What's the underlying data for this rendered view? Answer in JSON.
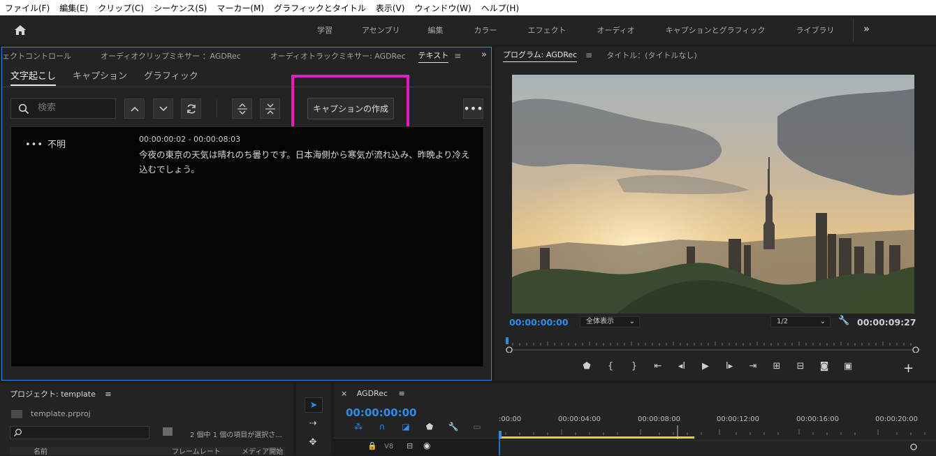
{
  "menu": [
    "ファイル(F)",
    "編集(E)",
    "クリップ(C)",
    "シーケンス(S)",
    "マーカー(M)",
    "グラフィックとタイトル",
    "表示(V)",
    "ウィンドウ(W)",
    "ヘルプ(H)"
  ],
  "workspaces": [
    "学習",
    "アセンブリ",
    "編集",
    "カラー",
    "エフェクト",
    "オーディオ",
    "キャプションとグラフィック",
    "ライブラリ"
  ],
  "workspaces_more": "»",
  "text_panel": {
    "tabs": [
      "ェクトコントロール",
      "オーディオクリップミキサー ：AGDRec",
      "オーディオトラックミキサー: AGDRec",
      "テキスト"
    ],
    "active_tab": "テキスト",
    "subtabs": [
      "文字起こし",
      "キャプション",
      "グラフィック"
    ],
    "search_placeholder": "検索",
    "create_captions_label": "キャプションの作成",
    "transcript": {
      "speaker": "不明",
      "timecode": "00:00:00:02 - 00:00:08:03",
      "text": "今夜の東京の天気は晴れのち曇りです。日本海側から寒気が流れ込み、昨晩より冷え込むでしょう。"
    }
  },
  "program": {
    "tab": "プログラム: AGDRec",
    "tab2": "タイトル：(タイトルなし)",
    "timecode_current": "00:00:00:00",
    "fit": "全体表示",
    "resolution": "1/2",
    "timecode_duration": "00:00:09:27"
  },
  "project": {
    "title": "プロジェクト: template",
    "file": "template.prproj",
    "selection_info": "2 個中 1 個の項目が選択さ...",
    "columns": [
      "名前",
      "フレームレート",
      "メディア開始"
    ]
  },
  "timeline": {
    "title": "AGDRec",
    "timecode": "00:00:00:00",
    "track_label": "V8",
    "ruler_labels": [
      ":00:00",
      "00:00:04:00",
      "00:00:08:00",
      "00:00:12:00",
      "00:00:16:00",
      "00:00:20:00"
    ]
  },
  "colors": {
    "accent": "#2d8ceb",
    "highlight": "#e41cbf",
    "panel": "#232323"
  }
}
